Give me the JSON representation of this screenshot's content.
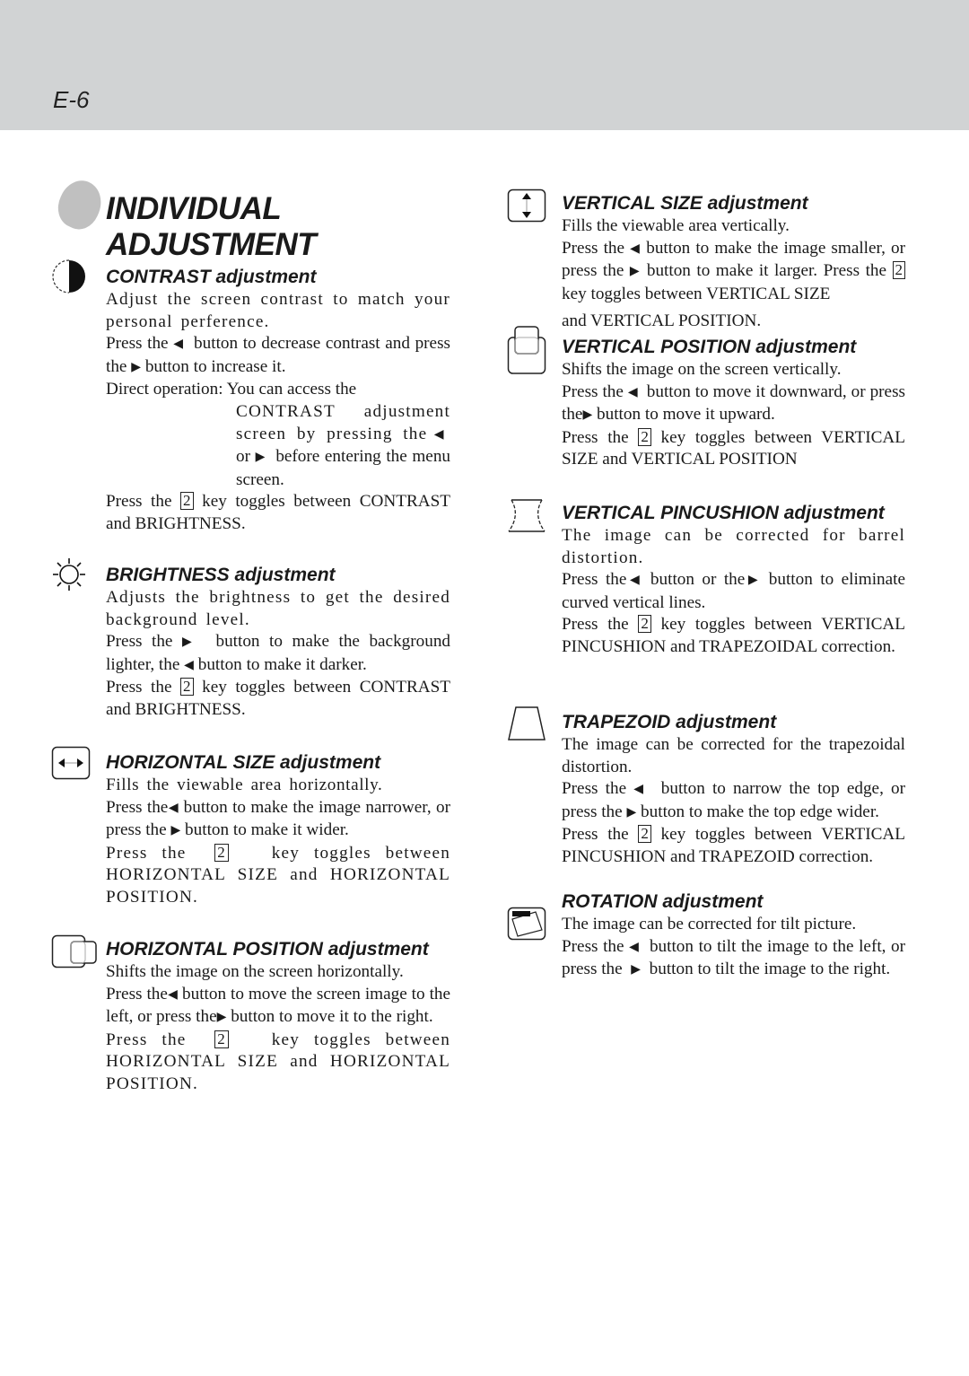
{
  "header": {
    "page_number": "E-6"
  },
  "title": {
    "line1": "INDIVIDUAL",
    "line2": "ADJUSTMENT"
  },
  "sections": {
    "contrast": {
      "icon": "contrast-icon",
      "title": "CONTRAST adjustment",
      "p1": "Adjust the screen contrast to match your personal perference.",
      "p2a": "Press the",
      "p2b": "button to decrease contrast and press the",
      "p2c": "button to increase it.",
      "p3": "Direct operation: You can access the",
      "p3b": "CONTRAST adjustment screen by pressing the",
      "p3c": "or",
      "p3d": "before entering the menu screen.",
      "p4a": "Press the",
      "p4b": "key toggles between CONTRAST and BRIGHTNESS."
    },
    "brightness": {
      "icon": "brightness-sun-icon",
      "title": "BRIGHTNESS adjustment",
      "p1": "Adjusts the brightness to get the desired background level.",
      "p2a": "Press the",
      "p2b": "button to make the background lighter, the",
      "p2c": "button to make it darker.",
      "p3a": "Press the",
      "p3b": "key toggles between CONTRAST and BRIGHTNESS."
    },
    "hsize": {
      "icon": "horizontal-size-icon",
      "title": "HORIZONTAL SIZE adjustment",
      "p1": "Fills the viewable area horizontally.",
      "p2a": "Press the",
      "p2b": "button to make the image narrower, or press the",
      "p2c": "button to make it wider.",
      "p3a": "Press the",
      "p3b": "key toggles between HORIZONTAL SIZE and HORIZONTAL POSITION."
    },
    "hpos": {
      "icon": "horizontal-position-icon",
      "title": "HORIZONTAL POSITION adjustment",
      "p1": "Shifts the image on the screen horizontally.",
      "p2a": "Press the",
      "p2b": "button to move the screen image to the left, or press the",
      "p2c": "button to move it to the right.",
      "p3a": "Press the",
      "p3b": "key toggles between HORIZONTAL SIZE and HORIZONTAL POSITION."
    },
    "vsize": {
      "icon": "vertical-size-icon",
      "title": "VERTICAL SIZE adjustment",
      "p1": "Fills the viewable area vertically.",
      "p2a": "Press the",
      "p2b": "button to make the image smaller, or press the",
      "p2c": "button to make it larger. Press the",
      "p2d": "key toggles between VERTICAL SIZE",
      "p3": "and VERTICAL POSITION."
    },
    "vpos": {
      "icon": "vertical-position-icon",
      "title": "VERTICAL POSITION adjustment",
      "p1": "Shifts the image on the screen vertically.",
      "p2a": "Press the",
      "p2b": "button to move it downward, or press the",
      "p2c": "button to move it upward.",
      "p3a": "Press the",
      "p3b": "key toggles between VERTICAL SIZE and VERTICAL POSITION"
    },
    "vpin": {
      "icon": "vertical-pincushion-icon",
      "title": "VERTICAL PINCUSHION adjustment",
      "p1": "The image can be corrected for barrel distortion.",
      "p2a": "Press the",
      "p2b": "button or the",
      "p2c": "button to eliminate curved vertical lines.",
      "p3a": "Press the",
      "p3b": "key toggles between VERTICAL PINCUSHION and TRAPEZOIDAL correction."
    },
    "trap": {
      "icon": "trapezoid-icon",
      "title": "TRAPEZOID adjustment",
      "p1": "The image can be corrected for the trapezoidal distortion.",
      "p2a": "Press the",
      "p2b": "button to narrow the top edge, or press the",
      "p2c": "button to make the top edge wider.",
      "p3a": "Press the",
      "p3b": "key toggles between VERTICAL PINCUSHION and TRAPEZOID correction."
    },
    "rot": {
      "icon": "rotation-icon",
      "title": "ROTATION adjustment",
      "p1": "The image can be corrected for tilt picture.",
      "p2a": "Press the",
      "p2b": "button to tilt the image to the left, or press the",
      "p2c": "button to tilt the image to the right."
    }
  },
  "glyphs": {
    "left": "◀",
    "right": "▶",
    "key": "2"
  }
}
